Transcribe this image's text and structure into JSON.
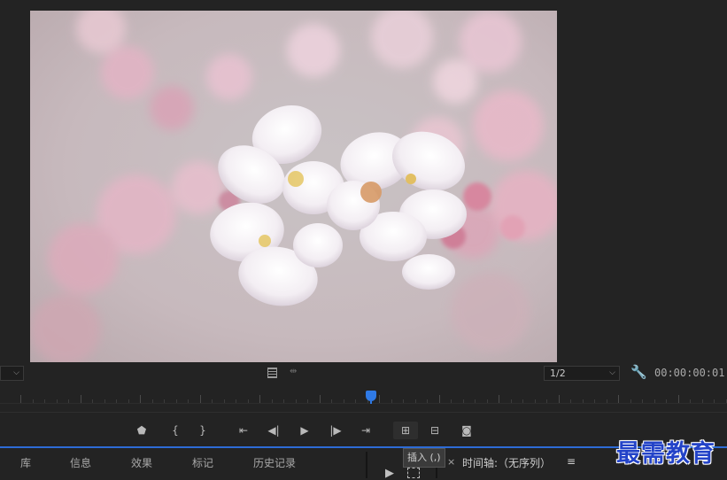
{
  "preview": {
    "image_name": "cherry-blossom-photo"
  },
  "controls": {
    "left_dropdown_value": "",
    "resolution_value": "1/2",
    "timecode": "00:00:00:01"
  },
  "transport": {
    "buttons": [
      {
        "name": "add-marker-button",
        "glyph": "⬟"
      },
      {
        "name": "mark-in-button",
        "glyph": "{"
      },
      {
        "name": "mark-out-button",
        "glyph": "}"
      },
      {
        "name": "go-to-in-button",
        "glyph": "⇤"
      },
      {
        "name": "step-back-button",
        "glyph": "◀|"
      },
      {
        "name": "play-button",
        "glyph": "▶"
      },
      {
        "name": "step-forward-button",
        "glyph": "|▶"
      },
      {
        "name": "go-to-out-button",
        "glyph": "⇥"
      },
      {
        "name": "insert-button",
        "glyph": "⊞"
      },
      {
        "name": "overwrite-button",
        "glyph": "⊟"
      },
      {
        "name": "export-frame-button",
        "glyph": "◙"
      }
    ]
  },
  "tooltip": "插入 (,)",
  "bottom_tabs": [
    "库",
    "信息",
    "效果",
    "标记",
    "历史记录"
  ],
  "timeline": {
    "close": "×",
    "title": "时间轴:（无序列）",
    "menu": "≡"
  },
  "watermark": "最需教育",
  "colors": {
    "background": "#232323",
    "accent_blue": "#2d6bd6",
    "watermark": "#2343c8"
  }
}
